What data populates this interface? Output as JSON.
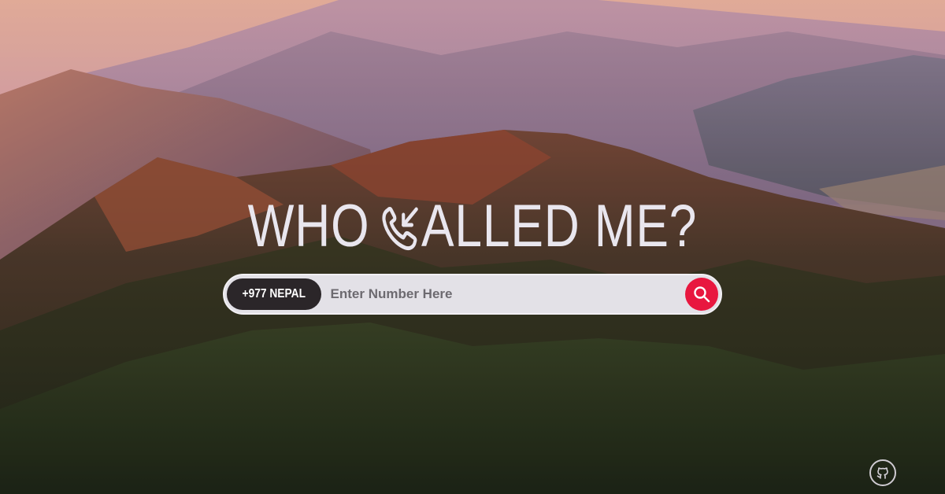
{
  "hero": {
    "title_part1": "WHO",
    "title_part2": "ALLED ME?",
    "title_icon": "phone-incoming-icon"
  },
  "search": {
    "country_label": "+977 NEPAL",
    "placeholder": "Enter Number Here",
    "value": "",
    "button_icon": "search-icon"
  },
  "footer": {
    "github_icon": "github-icon"
  },
  "colors": {
    "accent": "#e8173f",
    "title": "#e9e6ee",
    "pill_dark": "#2b2629",
    "input_bg": "#e3e1e7"
  },
  "background": "mountain-landscape-photo"
}
